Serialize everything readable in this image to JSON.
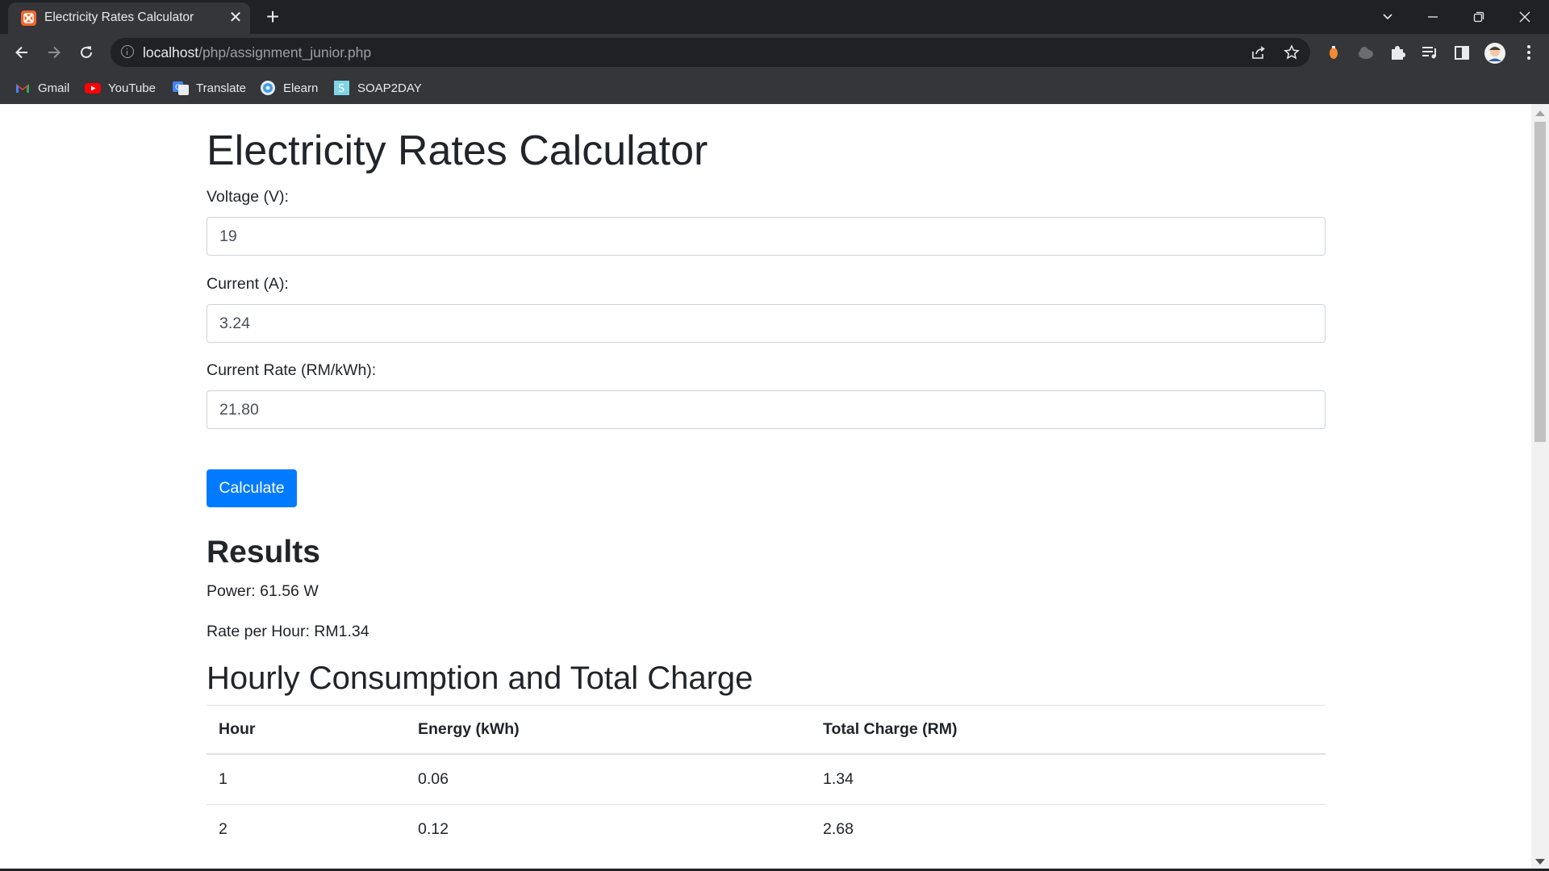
{
  "browser": {
    "tab_title": "Electricity Rates Calculator",
    "tab_close": "✕",
    "new_tab": "+",
    "url_host": "localhost",
    "url_path": "/php/assignment_junior.php",
    "bookmarks": [
      {
        "label": "Gmail",
        "icon": "gmail-icon"
      },
      {
        "label": "YouTube",
        "icon": "youtube-icon"
      },
      {
        "label": "Translate",
        "icon": "translate-icon"
      },
      {
        "label": "Elearn",
        "icon": "elearn-icon"
      },
      {
        "label": "SOAP2DAY",
        "icon": "soap2day-icon"
      }
    ]
  },
  "page": {
    "title": "Electricity Rates Calculator",
    "voltage_label": "Voltage (V):",
    "voltage_value": "19",
    "current_label": "Current (A):",
    "current_value": "3.24",
    "rate_label": "Current Rate (RM/kWh):",
    "rate_value": "21.80",
    "calculate_label": "Calculate",
    "results_heading": "Results",
    "power_text": "Power: 61.56 W",
    "rate_per_hour_text": "Rate per Hour: RM1.34",
    "table_heading": "Hourly Consumption and Total Charge",
    "table": {
      "headers": [
        "Hour",
        "Energy (kWh)",
        "Total Charge (RM)"
      ],
      "rows": [
        [
          "1",
          "0.06",
          "1.34"
        ],
        [
          "2",
          "0.12",
          "2.68"
        ]
      ]
    }
  },
  "colors": {
    "primary_button": "#007bff",
    "chrome_dark": "#202124",
    "chrome_toolbar": "#35363a"
  }
}
